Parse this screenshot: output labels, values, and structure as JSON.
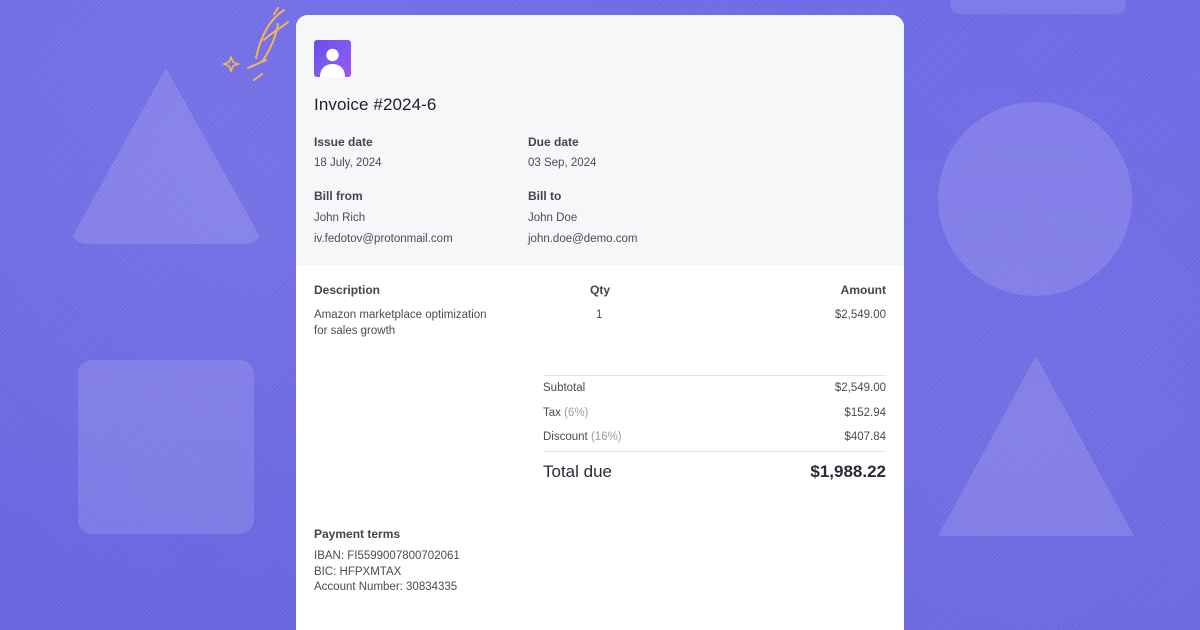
{
  "colors": {
    "background": "#6f6ae6",
    "card": "#ffffff",
    "card_header": "#f6f7f8",
    "avatar_gradient_start": "#6c4cf0",
    "avatar_gradient_end": "#a64ff0",
    "sparkle": "#f2b65a"
  },
  "icons": {
    "avatar": "user-avatar-icon",
    "sparkle": "sparkle-decoration-icon"
  },
  "invoice": {
    "title": "Invoice #2024-6",
    "issue_date_label": "Issue date",
    "issue_date": "18 July, 2024",
    "due_date_label": "Due date",
    "due_date": "03 Sep, 2024",
    "bill_from_label": "Bill from",
    "bill_from_name": "John Rich",
    "bill_from_email": "iv.fedotov@protonmail.com",
    "bill_to_label": "Bill to",
    "bill_to_name": "John Doe",
    "bill_to_email": "john.doe@demo.com"
  },
  "items": {
    "headers": {
      "description": "Description",
      "qty": "Qty",
      "amount": "Amount"
    },
    "rows": [
      {
        "description_line1": "Amazon marketplace optimization",
        "description_line2": "for sales growth",
        "qty": "1",
        "amount": "$2,549.00"
      }
    ]
  },
  "totals": {
    "subtotal_label": "Subtotal",
    "subtotal": "$2,549.00",
    "tax_label": "Tax",
    "tax_rate": "(6%)",
    "tax": "$152.94",
    "discount_label": "Discount",
    "discount_rate": "(16%)",
    "discount": "$407.84",
    "total_label": "Total due",
    "total": "$1,988.22"
  },
  "payment_terms": {
    "label": "Payment terms",
    "iban": "IBAN: FI5599007800702061",
    "bic": "BIC: HFPXMTAX",
    "account": "Account Number: 30834335"
  }
}
